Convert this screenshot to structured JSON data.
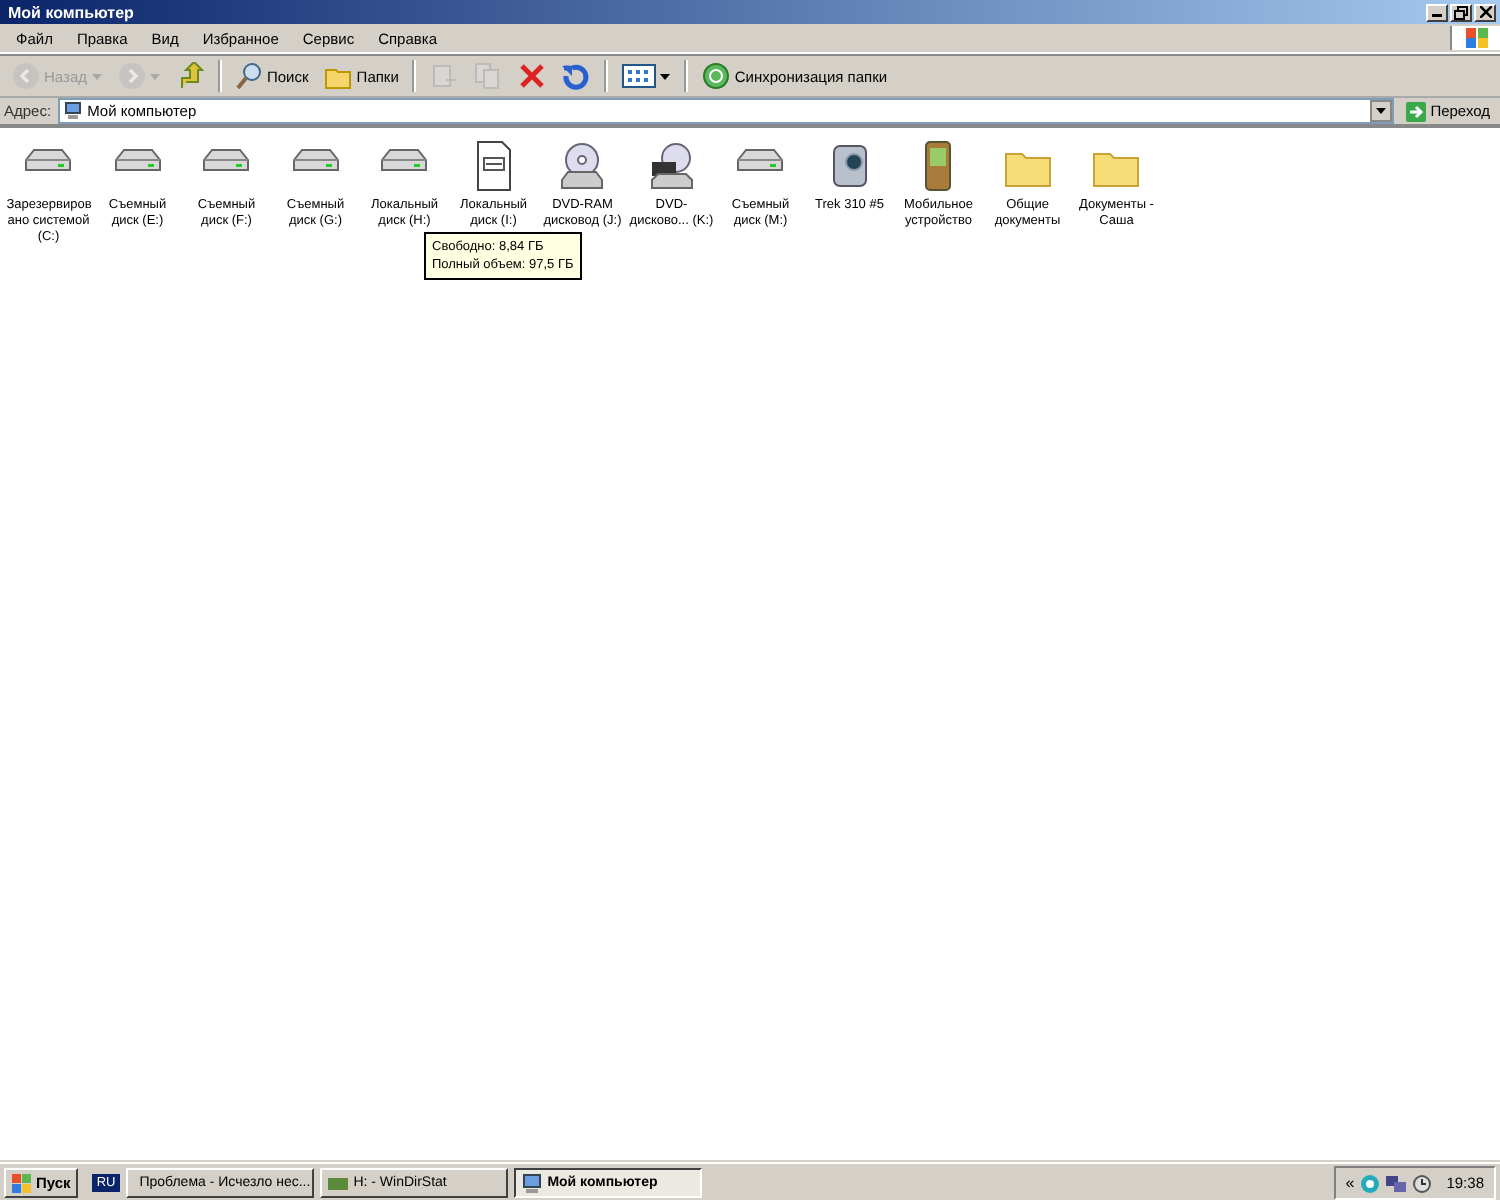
{
  "window": {
    "title": "Мой компьютер"
  },
  "menu": [
    "Файл",
    "Правка",
    "Вид",
    "Избранное",
    "Сервис",
    "Справка"
  ],
  "toolbar": [
    {
      "kind": "back",
      "label": "Назад",
      "disabled": true
    },
    {
      "kind": "forward",
      "disabled": true
    },
    {
      "kind": "up",
      "disabled": false
    },
    {
      "kind": "search",
      "label": "Поиск",
      "disabled": false
    },
    {
      "kind": "folders",
      "label": "Папки",
      "disabled": false
    },
    {
      "kind": "move",
      "disabled": true
    },
    {
      "kind": "copy",
      "disabled": true
    },
    {
      "kind": "delete",
      "disabled": false
    },
    {
      "kind": "undo",
      "disabled": false
    },
    {
      "kind": "views",
      "disabled": false
    },
    {
      "kind": "sync",
      "label": "Синхронизация папки",
      "disabled": false
    }
  ],
  "address": {
    "label": "Адрес:",
    "value": "Мой компьютер",
    "go": "Переход"
  },
  "items": [
    {
      "kind": "drive",
      "label": "Зарезервиров ано системой (C:)"
    },
    {
      "kind": "drive",
      "label": "Съемный диск (E:)"
    },
    {
      "kind": "drive",
      "label": "Съемный диск (F:)"
    },
    {
      "kind": "drive",
      "label": "Съемный диск (G:)"
    },
    {
      "kind": "drive",
      "label": "Локальный диск (H:)"
    },
    {
      "kind": "document",
      "label": "Локальный диск (I:)"
    },
    {
      "kind": "dvd",
      "label": "DVD-RAM дисковод (J:)"
    },
    {
      "kind": "dvdrw",
      "label": "DVD-дисково... (K:)"
    },
    {
      "kind": "drive",
      "label": "Съемный диск (M:)"
    },
    {
      "kind": "camera",
      "label": "Trek 310 #5"
    },
    {
      "kind": "mobile",
      "label": "Мобильное устройство"
    },
    {
      "kind": "folder",
      "label": "Общие документы"
    },
    {
      "kind": "folder",
      "label": "Документы - Саша"
    }
  ],
  "tooltip": [
    "Свободно: 8,84 ГБ",
    "Полный объем: 97,5 ГБ"
  ],
  "taskbar": {
    "start": "Пуск",
    "language": "RU",
    "tasks": [
      {
        "label": "Проблема - Исчезло нес...",
        "selected": false,
        "kind": "browser"
      },
      {
        "label": "H: - WinDirStat",
        "selected": false,
        "kind": "app"
      },
      {
        "label": "Мой компьютер",
        "selected": true,
        "kind": "computer"
      }
    ],
    "tray_expand": "«",
    "time": "19:38"
  }
}
